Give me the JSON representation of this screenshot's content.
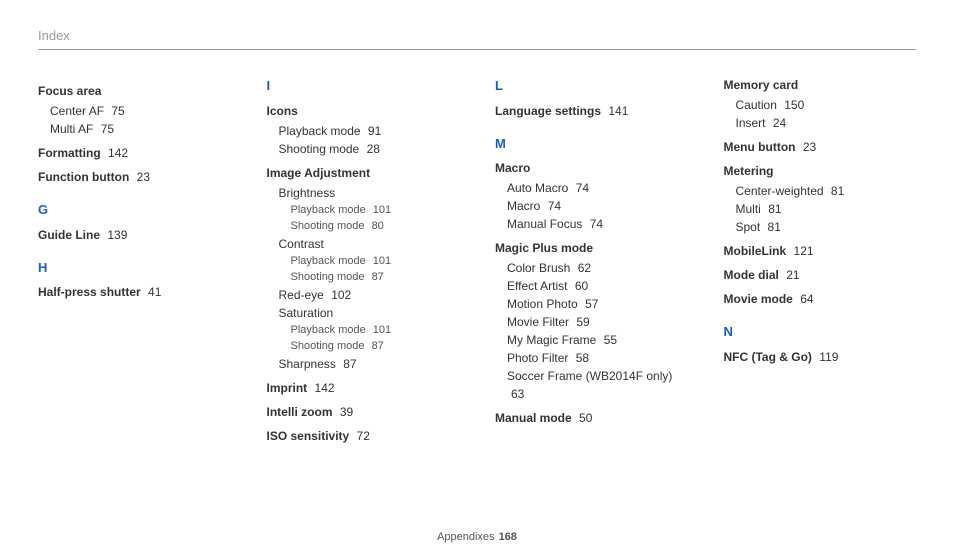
{
  "header": "Index",
  "footer": {
    "label": "Appendixes",
    "page": "168"
  },
  "col1": {
    "e1": {
      "t": "Focus area"
    },
    "e1s1": {
      "t": "Center AF",
      "p": "75"
    },
    "e1s2": {
      "t": "Multi AF",
      "p": "75"
    },
    "e2": {
      "t": "Formatting",
      "p": "142"
    },
    "e3": {
      "t": "Function button",
      "p": "23"
    },
    "lG": "G",
    "e4": {
      "t": "Guide Line",
      "p": "139"
    },
    "lH": "H",
    "e5": {
      "t": "Half-press shutter",
      "p": "41"
    }
  },
  "col2": {
    "lI": "I",
    "e1": {
      "t": "Icons"
    },
    "e1s1": {
      "t": "Playback mode",
      "p": "91"
    },
    "e1s2": {
      "t": "Shooting mode",
      "p": "28"
    },
    "e2": {
      "t": "Image Adjustment"
    },
    "e2s1": {
      "t": "Brightness"
    },
    "e2s1a": {
      "t": "Playback mode",
      "p": "101"
    },
    "e2s1b": {
      "t": "Shooting mode",
      "p": "80"
    },
    "e2s2": {
      "t": "Contrast"
    },
    "e2s2a": {
      "t": "Playback mode",
      "p": "101"
    },
    "e2s2b": {
      "t": "Shooting mode",
      "p": "87"
    },
    "e2s3": {
      "t": "Red-eye",
      "p": "102"
    },
    "e2s4": {
      "t": "Saturation"
    },
    "e2s4a": {
      "t": "Playback mode",
      "p": "101"
    },
    "e2s4b": {
      "t": "Shooting mode",
      "p": "87"
    },
    "e2s5": {
      "t": "Sharpness",
      "p": "87"
    },
    "e3": {
      "t": "Imprint",
      "p": "142"
    },
    "e4": {
      "t": "Intelli zoom",
      "p": "39"
    },
    "e5": {
      "t": "ISO sensitivity",
      "p": "72"
    }
  },
  "col3": {
    "lL": "L",
    "e1": {
      "t": "Language settings",
      "p": "141"
    },
    "lM": "M",
    "e2": {
      "t": "Macro"
    },
    "e2s1": {
      "t": "Auto Macro",
      "p": "74"
    },
    "e2s2": {
      "t": "Macro",
      "p": "74"
    },
    "e2s3": {
      "t": "Manual Focus",
      "p": "74"
    },
    "e3": {
      "t": "Magic Plus mode"
    },
    "e3s1": {
      "t": "Color Brush",
      "p": "62"
    },
    "e3s2": {
      "t": "Effect Artist",
      "p": "60"
    },
    "e3s3": {
      "t": "Motion Photo",
      "p": "57"
    },
    "e3s4": {
      "t": "Movie Filter",
      "p": "59"
    },
    "e3s5": {
      "t": "My Magic Frame",
      "p": "55"
    },
    "e3s6": {
      "t": "Photo Filter",
      "p": "58"
    },
    "e3s7": {
      "t": "Soccer Frame (WB2014F only)",
      "p": "63"
    },
    "e4": {
      "t": "Manual mode",
      "p": "50"
    }
  },
  "col4": {
    "e1": {
      "t": "Memory card"
    },
    "e1s1": {
      "t": "Caution",
      "p": "150"
    },
    "e1s2": {
      "t": "Insert",
      "p": "24"
    },
    "e2": {
      "t": "Menu button",
      "p": "23"
    },
    "e3": {
      "t": "Metering"
    },
    "e3s1": {
      "t": "Center-weighted",
      "p": "81"
    },
    "e3s2": {
      "t": "Multi",
      "p": "81"
    },
    "e3s3": {
      "t": "Spot",
      "p": "81"
    },
    "e4": {
      "t": "MobileLink",
      "p": "121"
    },
    "e5": {
      "t": "Mode dial",
      "p": "21"
    },
    "e6": {
      "t": "Movie mode",
      "p": "64"
    },
    "lN": "N",
    "e7": {
      "t": "NFC (Tag & Go)",
      "p": "119"
    }
  }
}
